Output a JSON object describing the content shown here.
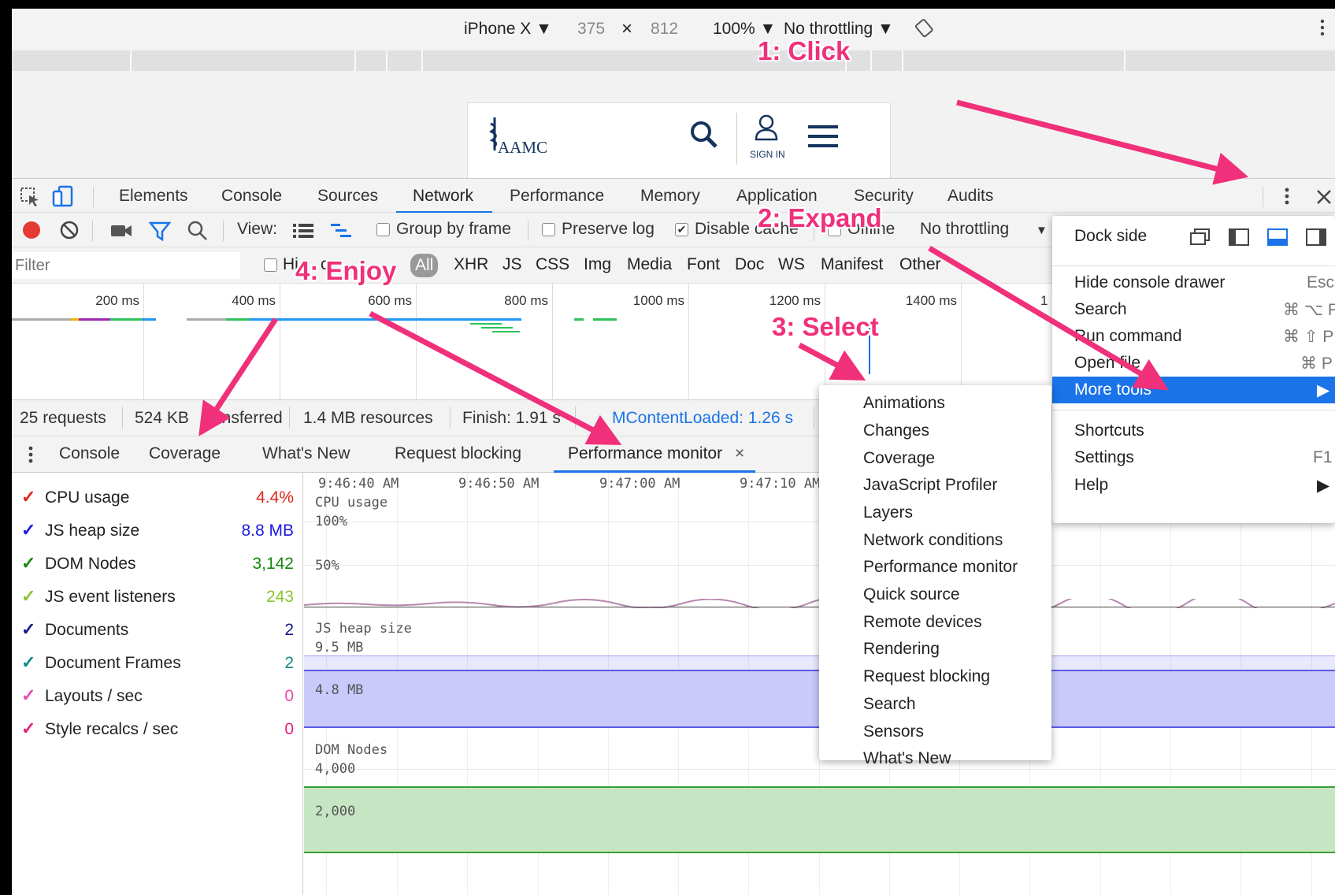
{
  "device_toolbar": {
    "device": "iPhone X ▼",
    "width": "375",
    "times": "×",
    "height": "812",
    "zoom": "100% ▼",
    "throttling": "No throttling ▼"
  },
  "site": {
    "logo_text": "AAMC",
    "sign_in": "SIGN IN"
  },
  "devtools_tabs": [
    "Elements",
    "Console",
    "Sources",
    "Network",
    "Performance",
    "Memory",
    "Application",
    "Security",
    "Audits"
  ],
  "active_tab": "Network",
  "network_toolbar": {
    "view_label": "View:",
    "group_by_frame": "Group by frame",
    "preserve_log": "Preserve log",
    "disable_cache": "Disable cache",
    "offline": "Offline",
    "throttling": "No throttling"
  },
  "filter": {
    "placeholder": "Filter",
    "hide_data_urls_fragment": "Hi",
    "hide_data_urls_fragment2": "c",
    "types": [
      "All",
      "XHR",
      "JS",
      "CSS",
      "Img",
      "Media",
      "Font",
      "Doc",
      "WS",
      "Manifest",
      "Other"
    ]
  },
  "timeline_labels": [
    "200 ms",
    "400 ms",
    "600 ms",
    "800 ms",
    "1000 ms",
    "1200 ms",
    "1400 ms",
    "1"
  ],
  "summary": {
    "requests": "25 requests",
    "transferred_a": "524 KB",
    "transferred_b": "ransferred",
    "resources": "1.4 MB resources",
    "finish": "Finish: 1.91 s",
    "dcl": "MContentLoaded: 1.26 s"
  },
  "drawer_tabs": [
    "Console",
    "Coverage",
    "What's New",
    "Request blocking",
    "Performance monitor"
  ],
  "drawer_close": "×",
  "metrics": [
    {
      "name": "CPU usage",
      "value": "4.4%",
      "color": "#e0241d"
    },
    {
      "name": "JS heap size",
      "value": "8.8 MB",
      "color": "#1a1ae0"
    },
    {
      "name": "DOM Nodes",
      "value": "3,142",
      "color": "#16880c"
    },
    {
      "name": "JS event listeners",
      "value": "243",
      "color": "#8ac431"
    },
    {
      "name": "Documents",
      "value": "2",
      "color": "#141c8c"
    },
    {
      "name": "Document Frames",
      "value": "2",
      "color": "#0f8a8a"
    },
    {
      "name": "Layouts / sec",
      "value": "0",
      "color": "#e64ab0"
    },
    {
      "name": "Style recalcs / sec",
      "value": "0",
      "color": "#e6207a"
    }
  ],
  "graph": {
    "times": [
      "9:46:40 AM",
      "9:46:50 AM",
      "9:47:00 AM",
      "9:47:10 AM"
    ],
    "cpu_title": "CPU usage",
    "cpu_100": "100%",
    "cpu_50": "50%",
    "heap_title": "JS heap size",
    "heap_max": "9.5 MB",
    "heap_mid": "4.8 MB",
    "dom_title": "DOM Nodes",
    "dom_max": "4,000",
    "dom_mid": "2,000"
  },
  "more_tools_menu": [
    "Animations",
    "Changes",
    "Coverage",
    "JavaScript Profiler",
    "Layers",
    "Network conditions",
    "Performance monitor",
    "Quick source",
    "Remote devices",
    "Rendering",
    "Request blocking",
    "Search",
    "Sensors",
    "What's New"
  ],
  "main_menu": {
    "dock_side": "Dock side",
    "items": [
      {
        "label": "Hide console drawer",
        "shortcut": "Esc"
      },
      {
        "label": "Search",
        "shortcut": "⌘ ⌥ F"
      },
      {
        "label": "Run command",
        "shortcut": "⌘ ⇧ P"
      },
      {
        "label": "Open file",
        "shortcut": "⌘ P"
      },
      {
        "label": "More tools",
        "shortcut": "▶"
      }
    ],
    "items2": [
      {
        "label": "Shortcuts",
        "shortcut": ""
      },
      {
        "label": "Settings",
        "shortcut": "F1"
      },
      {
        "label": "Help",
        "shortcut": "▶"
      }
    ]
  },
  "annotations": [
    "1: Click",
    "2: Expand",
    "3: Select",
    "4: Enjoy"
  ],
  "colors": {
    "accent": "#1a73e8",
    "annotation": "#f0307a",
    "heap_fill": "#c9c9fa",
    "dom_fill": "#c6e6c3"
  }
}
